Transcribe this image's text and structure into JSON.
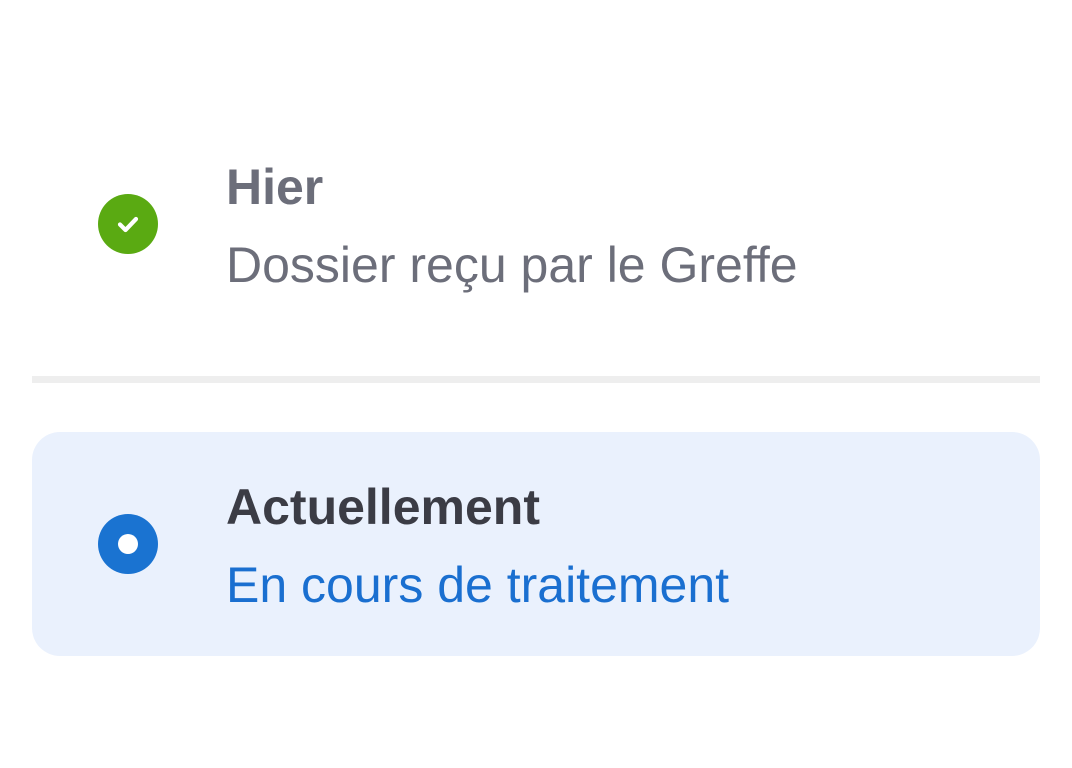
{
  "timeline": {
    "steps": [
      {
        "status": "done",
        "icon": "check-circle-icon",
        "color": "#5aaa12",
        "title": "Hier",
        "description": "Dossier reçu par le Greffe"
      },
      {
        "status": "current",
        "icon": "radio-dot-icon",
        "color": "#1a73d1",
        "title": "Actuellement",
        "description": "En cours de traitement"
      }
    ]
  },
  "colors": {
    "current_highlight": "#eaf1fd",
    "divider": "#eeeeee",
    "muted_text": "#6c6e7a",
    "current_description": "#1a6fd0"
  }
}
